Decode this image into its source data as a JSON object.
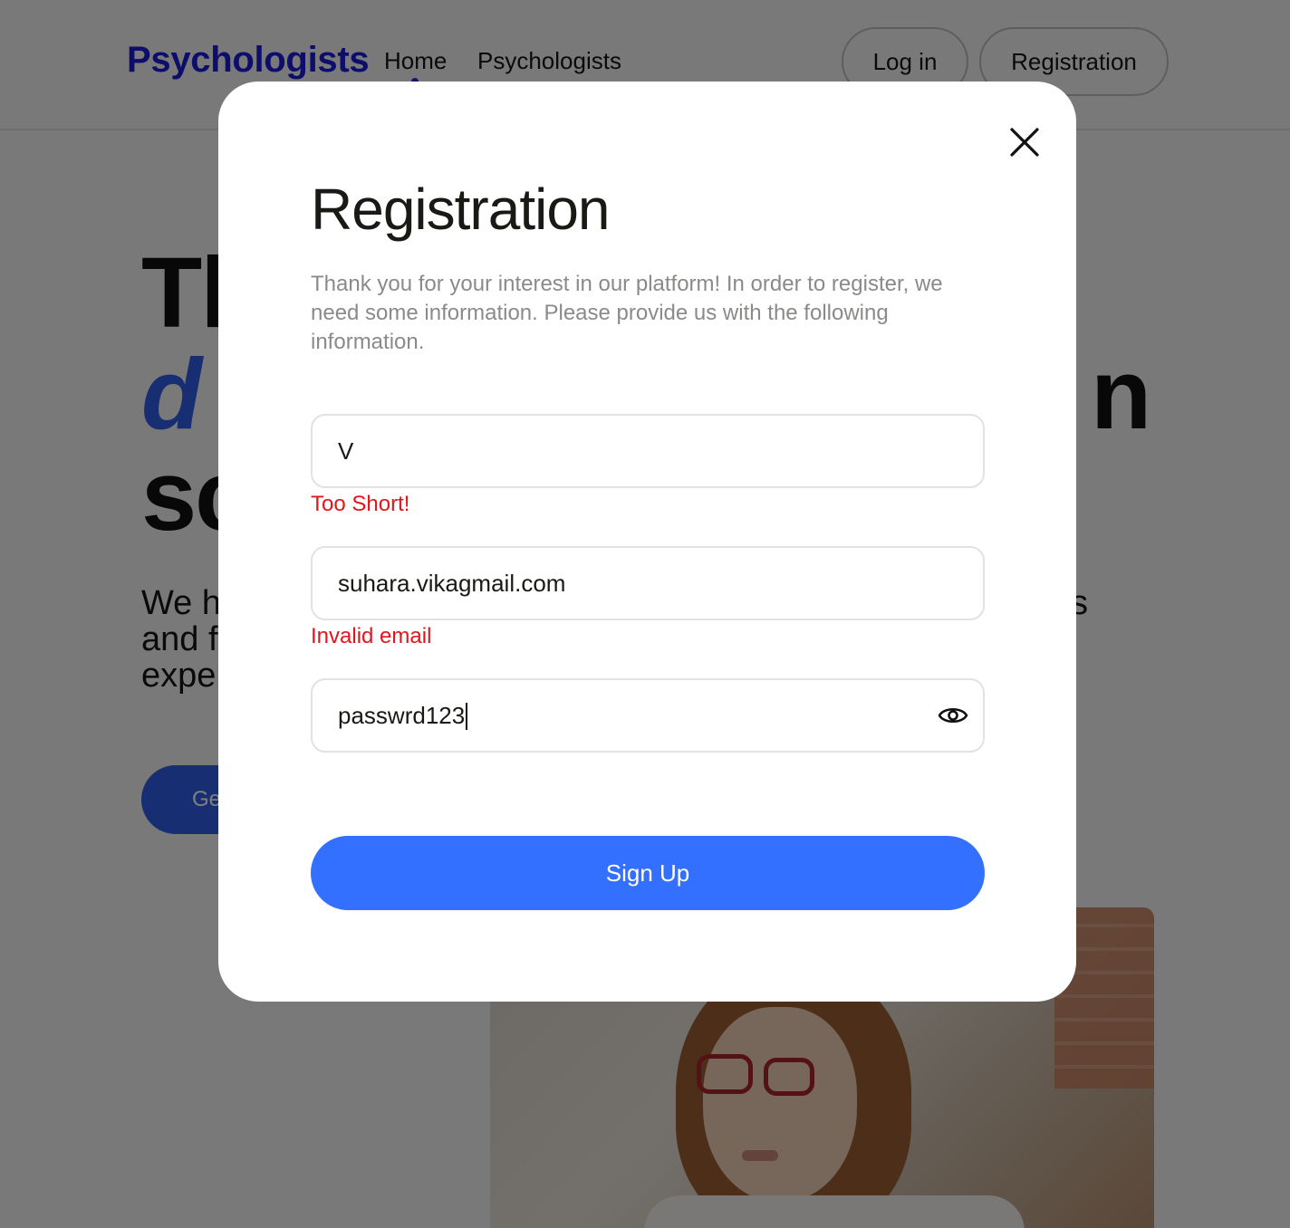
{
  "header": {
    "logo": "Psychologists",
    "nav": [
      {
        "label": "Home"
      },
      {
        "label": "Psychologists"
      }
    ],
    "login_label": "Log in",
    "register_label": "Registration"
  },
  "hero": {
    "title_line1": "Tl",
    "title_line2": "d",
    "title_line2_right": "n",
    "title_line3": "sc",
    "subtitle_line1": "We h",
    "subtitle_line1_right": "s",
    "subtitle_line2": "and f",
    "subtitle_line3": "expe",
    "cta_label": "Ge"
  },
  "modal": {
    "title": "Registration",
    "description": "Thank you for your interest in our platform! In order to register, we need some information. Please provide us with the following information.",
    "fields": {
      "name": {
        "value": "V",
        "error": "Too Short!"
      },
      "email": {
        "value": "suhara.vikagmail.com",
        "error": "Invalid email"
      },
      "password": {
        "value": "passwrd123"
      }
    },
    "submit_label": "Sign Up"
  },
  "colors": {
    "accent": "#3470ff",
    "logo": "#1a1ad6",
    "error": "#e3151c",
    "overlay": "rgba(0,0,0,0.5)"
  },
  "icons": {
    "close": "close-icon",
    "password_visibility": "eye-icon"
  }
}
